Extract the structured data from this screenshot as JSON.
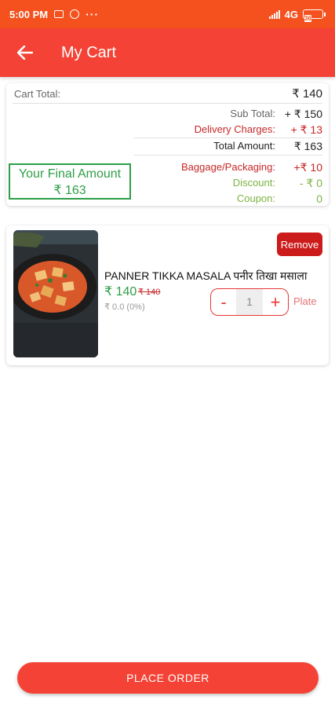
{
  "status_bar": {
    "time": "5:00 PM",
    "network": "4G",
    "battery": "36"
  },
  "app_bar": {
    "title": "My Cart"
  },
  "summary": {
    "cart_total_label": "Cart Total:",
    "cart_total_value": "₹ 140",
    "sub_total_label": "Sub Total:",
    "sub_total_value": "+ ₹ 150",
    "delivery_label": "Delivery Charges:",
    "delivery_value": "+ ₹ 13",
    "total_amount_label": "Total Amount:",
    "total_amount_value": "₹ 163",
    "baggage_label": "Baggage/Packaging:",
    "baggage_value": "+₹ 10",
    "discount_label": "Discount:",
    "discount_value": "- ₹ 0",
    "coupon_label": "Coupon:",
    "coupon_value": "0",
    "final_amount_label": "Your Final Amount",
    "final_amount_value": "₹ 163"
  },
  "items": [
    {
      "name": "PANNER TIKKA MASALA पनीर तिखा मसाला",
      "price": "₹ 140",
      "old_price": "₹ 140",
      "discount": "₹ 0.0 (0%)",
      "quantity": "1",
      "unit": "Plate",
      "remove_label": "Remove",
      "minus_label": "-",
      "plus_label": "+"
    }
  ],
  "footer": {
    "place_order_label": "PLACE ORDER"
  },
  "colors": {
    "status_bar": "#f4511e",
    "primary": "#f44336",
    "remove": "#cc1b1b",
    "green": "#2e9e48",
    "red_text": "#c62828",
    "olive_text": "#7cb342"
  },
  "icons": {
    "back": "back-arrow-icon"
  }
}
